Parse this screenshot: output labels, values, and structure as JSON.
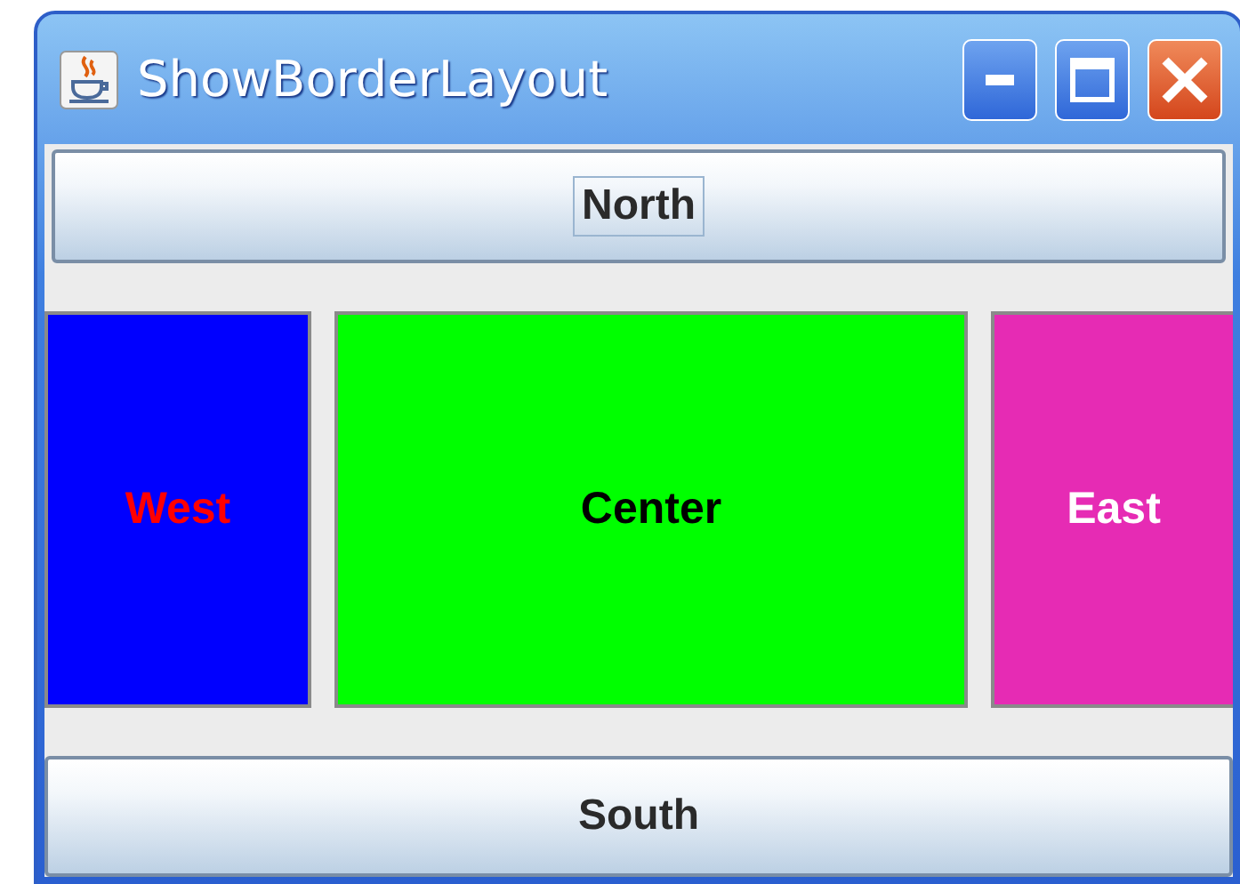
{
  "window": {
    "title": "ShowBorderLayout"
  },
  "north": {
    "label": "North",
    "focused": true
  },
  "panels": [
    {
      "color": "#0000ff",
      "label": {
        "text": "West",
        "color": "#ff0000"
      }
    },
    {
      "color": "#00ff00",
      "label": {
        "text": "Center",
        "color": "#000000"
      }
    },
    {
      "color": "#e62bb4",
      "label": {
        "text": "East",
        "color": "#ffffff"
      }
    }
  ],
  "south": {
    "label": "South",
    "focused": false
  }
}
